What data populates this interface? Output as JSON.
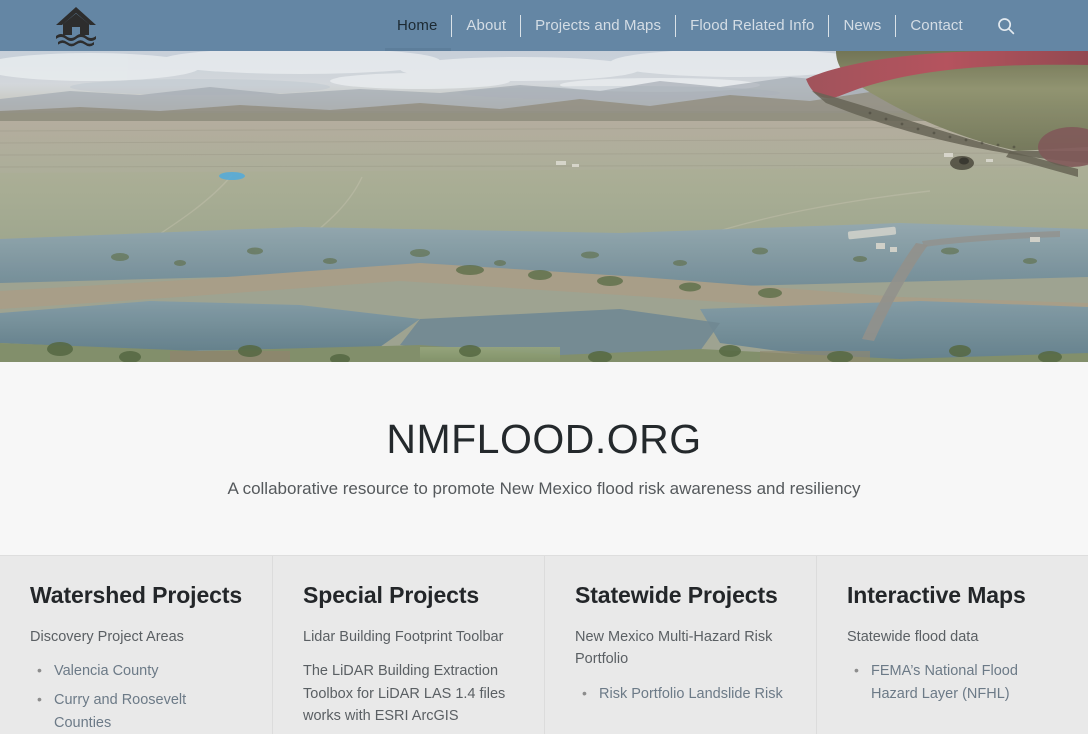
{
  "header": {
    "logo_alt": "NMFlood home logo",
    "nav_items": [
      {
        "label": "Home",
        "active": true
      },
      {
        "label": "About",
        "active": false
      },
      {
        "label": "Projects and Maps",
        "active": false
      },
      {
        "label": "Flood Related Info",
        "active": false
      },
      {
        "label": "News",
        "active": false
      },
      {
        "label": "Contact",
        "active": false
      }
    ],
    "search_icon": "search-icon",
    "background_color": "#6486a4"
  },
  "hero": {
    "description": "Aerial photograph taken from a small airplane showing a flooded New Mexico river valley with mountains on the horizon, an airplane wing with a red leading edge at the upper right, and a highway crossing the floodplain"
  },
  "intro": {
    "title": "NMFLOOD.ORG",
    "subtitle": "A collaborative resource to promote New Mexico flood risk awareness and resiliency"
  },
  "columns": [
    {
      "title": "Watershed Projects",
      "subtitle": "Discovery Project Areas",
      "links": [
        "Valencia County",
        "Curry and Roosevelt Counties"
      ],
      "paragraph": ""
    },
    {
      "title": "Special Projects",
      "subtitle": "Lidar Building Footprint Toolbar",
      "links": [],
      "paragraph": "The LiDAR Building Extraction Toolbox  for LiDAR LAS 1.4 files works with ESRI ArcGIS"
    },
    {
      "title": "Statewide Projects",
      "subtitle": "New Mexico Multi-Hazard Risk Portfolio",
      "links": [
        "Risk Portfolio Landslide Risk"
      ],
      "paragraph": ""
    },
    {
      "title": "Interactive Maps",
      "subtitle": "Statewide flood data",
      "links": [
        "FEMA’s National Flood Hazard Layer (NFHL)"
      ],
      "paragraph": ""
    }
  ]
}
